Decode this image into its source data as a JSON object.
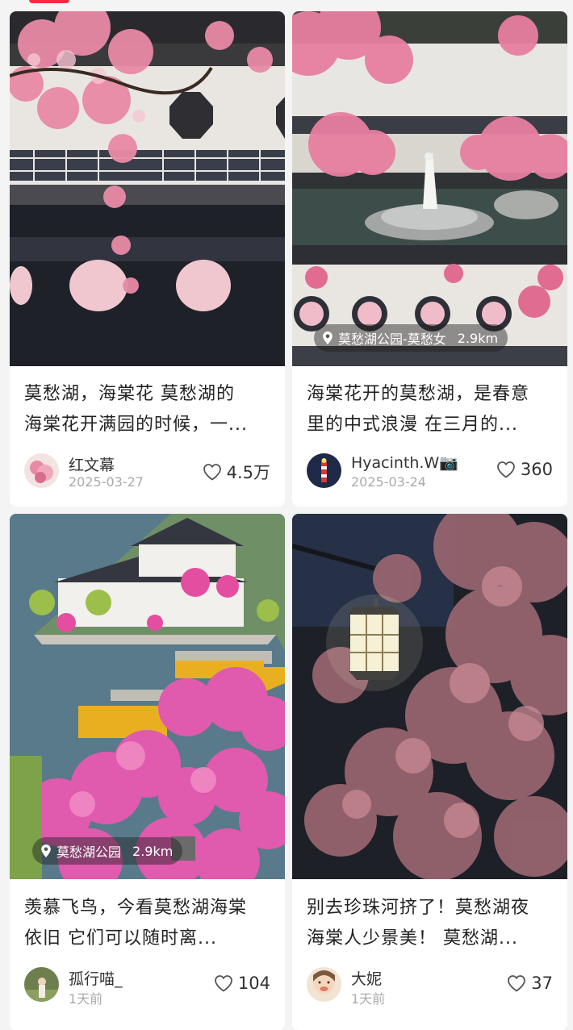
{
  "feed": {
    "posts": [
      {
        "title_line1": "莫愁湖，海棠花 莫愁湖的",
        "title_line2": "海棠花开满园的时候，一...",
        "author": "红文幕",
        "date": "2025-03-27",
        "likes": "4.5万"
      },
      {
        "location": "莫愁湖公园-莫愁女",
        "distance": "2.9km",
        "title_line1": "海棠花开的莫愁湖，是春意",
        "title_line2": "里的中式浪漫 在三月的...",
        "author": "Hyacinth.W📷",
        "date": "2025-03-24",
        "likes": "360"
      },
      {
        "location": "莫愁湖公园",
        "distance": "2.9km",
        "title_line1": "羡慕飞鸟，今看莫愁湖海棠",
        "title_line2": "依旧 它们可以随时离...",
        "author": "孤行喵_",
        "date": "1天前",
        "likes": "104"
      },
      {
        "title_line1": "别去珍珠河挤了！莫愁湖夜",
        "title_line2": "海棠人少景美！ 莫愁湖...",
        "author": "大妮",
        "date": "1天前",
        "likes": "37"
      }
    ]
  },
  "icons": {
    "location": "location-pin-icon",
    "like": "heart-icon"
  },
  "colors": {
    "accent": "#ff2742",
    "blossom": "#e88aa6"
  }
}
